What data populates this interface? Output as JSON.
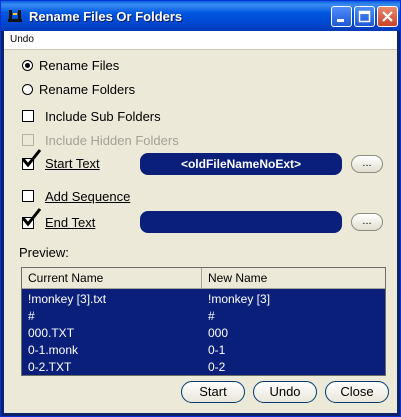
{
  "window": {
    "title": "Rename Files Or Folders"
  },
  "menu": {
    "undo": "Undo"
  },
  "options": {
    "rename_files": "Rename Files",
    "rename_folders": "Rename Folders",
    "include_sub_folders": "Include Sub Folders",
    "include_hidden_folders": "Include Hidden Folders",
    "start_text": "Start Text",
    "add_sequence": "Add Sequence",
    "end_text": "End Text"
  },
  "fields": {
    "start_text_value": "<oldFileNameNoExt>",
    "end_text_value": "",
    "browse_label": "..."
  },
  "preview": {
    "label": "Preview:",
    "columns": [
      "Current Name",
      "New Name"
    ],
    "rows": [
      [
        "!monkey [3].txt",
        "!monkey [3]"
      ],
      [
        "#",
        "#"
      ],
      [
        "000.TXT",
        "000"
      ],
      [
        "0-1.monk",
        "0-1"
      ],
      [
        "0-2.TXT",
        "0-2"
      ]
    ]
  },
  "buttons": {
    "start": "Start",
    "undo": "Undo",
    "close": "Close"
  },
  "colors": {
    "selection": "#0a1f7a",
    "title_bar": "#0046d0",
    "face": "#ece9d8"
  }
}
